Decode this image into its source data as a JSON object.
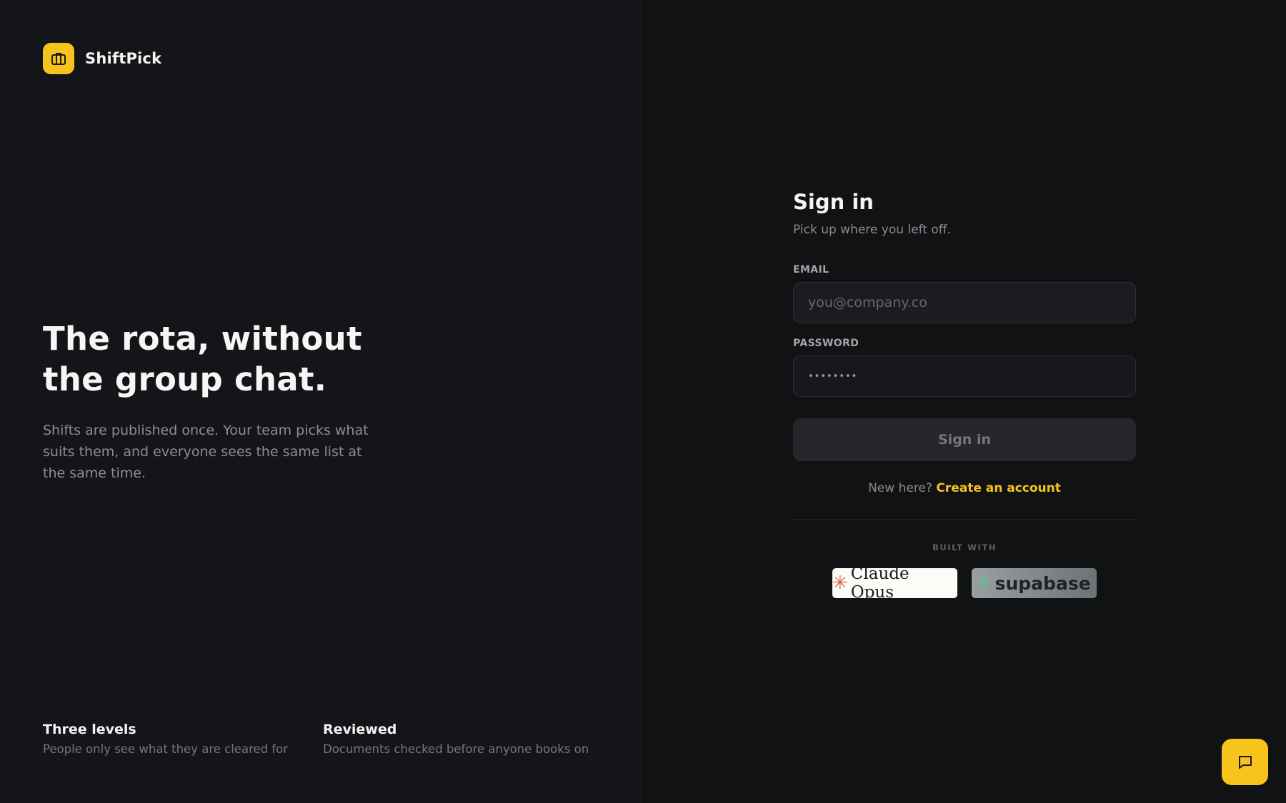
{
  "brand": {
    "name": "ShiftPick",
    "logo_icon": "briefcase-icon",
    "accent": "#f6c41b"
  },
  "hero": {
    "title": "The rota, without the group chat.",
    "subtitle": "Shifts are published once. Your team picks what suits them, and everyone sees the same list at the same time."
  },
  "features": [
    {
      "title": "Three levels",
      "desc": "People only see what they are cleared for"
    },
    {
      "title": "Reviewed",
      "desc": "Documents checked before anyone books on"
    }
  ],
  "signin": {
    "title": "Sign in",
    "subtitle": "Pick up where you left off.",
    "email_label": "EMAIL",
    "email_placeholder": "you@company.co",
    "password_label": "PASSWORD",
    "password_value": "••••••••",
    "button_label": "Sign in",
    "register_prompt": "New here?",
    "register_link": "Create an account"
  },
  "built_with": {
    "label": "BUILT WITH",
    "badges": [
      {
        "name": "Claude Opus",
        "icon": "claude-star-icon",
        "color": "#d8633d"
      },
      {
        "name": "supabase",
        "icon": "supabase-bolt-icon",
        "color": "#3ecf8e"
      }
    ]
  },
  "chat": {
    "icon": "chat-bubble-icon"
  }
}
